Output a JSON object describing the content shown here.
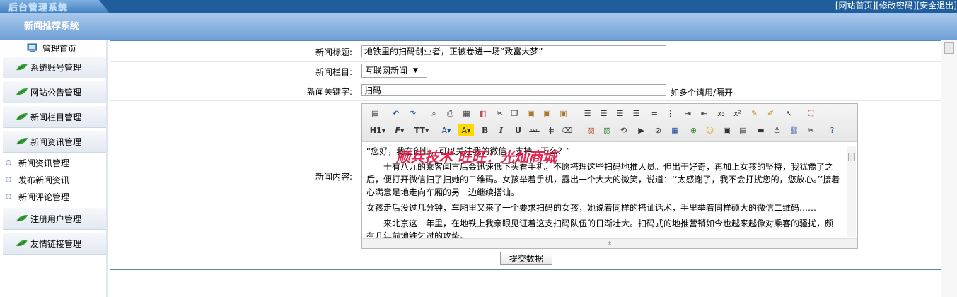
{
  "header": {
    "logo_text": "后台管理系统",
    "links": [
      "[网站首页]",
      "[修改密码]",
      "[安全退出]"
    ],
    "subtitle": "新闻推荐系统"
  },
  "sidebar": {
    "home": "管理首页",
    "menus": [
      "系统账号管理",
      "网站公告管理",
      "新闻栏目管理",
      "新闻资讯管理",
      "注册用户管理",
      "友情链接管理"
    ],
    "subitems": [
      "新闻资讯管理",
      "发布新闻资讯",
      "新闻评论管理"
    ]
  },
  "form": {
    "title_label": "新闻标题:",
    "title_value": "地铁里的扫码创业者，正被卷进一场“致富大梦”",
    "category_label": "新闻栏目:",
    "category_value": "互联网新闻",
    "keyword_label": "新闻关键字:",
    "keyword_value": "扫码",
    "keyword_hint": "如多个请用/隔开",
    "content_label": "新闻内容:",
    "submit_label": "提交数据"
  },
  "editor": {
    "toolbar_row2_text": {
      "heading": "H1",
      "font": "F",
      "size": "TT",
      "font_color": "A",
      "bg_color": "A",
      "bold": "B",
      "italic": "I",
      "underline": "U",
      "strike": "ABC"
    },
    "paragraphs": [
      "“您好，我在创业，可以关注我的微信，支持一下么？”",
      "　　十有八九的乘客闻言后会迅速低下头看手机，不愿搭理这些扫码地推人员。但出于好奇，再加上女孩的坚持，我犹豫了之后，便打开微信扫了扫她的二维码。女孩举着手机，露出一个大大的微笑，说道：‘‘太感谢了，我不会打扰您的，您放心。’’接着心满意足地走向车厢的另一边继续搭讪。",
      "女孩走后没过几分钟，车厢里又来了一个要求扫码的女孩，她说着同样的搭讪话术，手里举着同样硕大的微信二维码……",
      "　　来北京这一年里，在地铁上我亲眼见证着这支扫码队伍的日渐壮大。扫码式的地推营销如今也越来越像对乘客的骚扰，颇有几年前地铁乞讨的攻势。"
    ],
    "watermark": "顺兵技术 旺旺：光灿商城"
  }
}
